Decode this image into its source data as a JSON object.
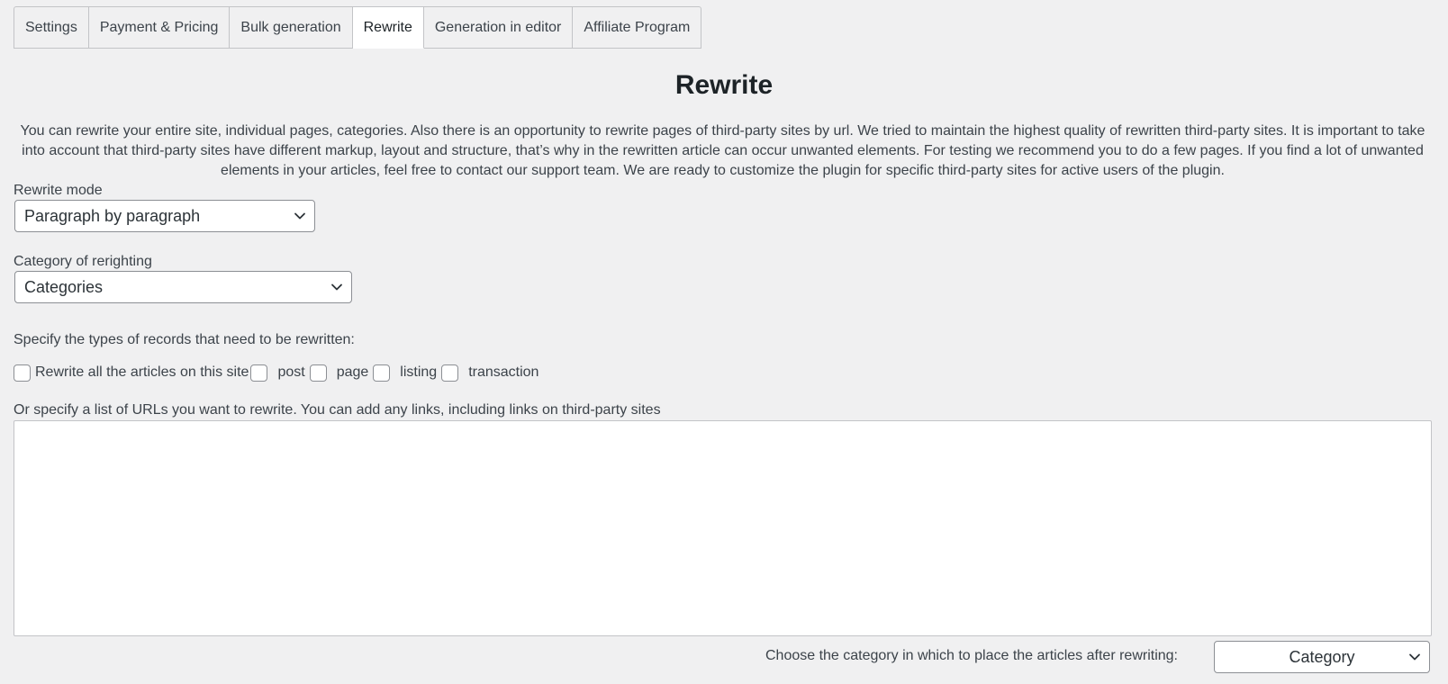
{
  "tabs": [
    {
      "label": "Settings",
      "active": false
    },
    {
      "label": "Payment & Pricing",
      "active": false
    },
    {
      "label": "Bulk generation",
      "active": false
    },
    {
      "label": "Rewrite",
      "active": true
    },
    {
      "label": "Generation in editor",
      "active": false
    },
    {
      "label": "Affiliate Program",
      "active": false
    }
  ],
  "page": {
    "title": "Rewrite",
    "intro": "You can rewrite your entire site, individual pages, categories. Also there is an opportunity to rewrite pages of third-party sites by url. We tried to maintain the highest quality of rewritten third-party sites. It is important to take into account that third-party sites have different markup, layout and structure, that’s why in the rewritten article can occur unwanted elements. For testing we recommend you to do a few pages. If you find a lot of unwanted elements in your articles, feel free to contact our support team. We are ready to customize the plugin for specific third-party sites for active users of the plugin."
  },
  "rewrite_mode": {
    "label": "Rewrite mode",
    "value": "Paragraph by paragraph"
  },
  "category_rewrite": {
    "label": "Category of rerighting",
    "value": "Categories"
  },
  "record_types": {
    "label": "Specify the types of records that need to be rewritten:",
    "options": [
      {
        "label": "Rewrite all the articles on this site",
        "checked": false
      },
      {
        "label": "post",
        "checked": false
      },
      {
        "label": "page",
        "checked": false
      },
      {
        "label": "listing",
        "checked": false
      },
      {
        "label": "transaction",
        "checked": false
      }
    ]
  },
  "urls": {
    "label": "Or specify a list of URLs you want to rewrite. You can add any links, including links on third-party sites",
    "value": ""
  },
  "target_category": {
    "label": "Choose the category in which to place the articles after rewriting:",
    "value": "Category"
  },
  "colors": {
    "background": "#f0f0f1",
    "border": "#c3c4c7",
    "text": "#3c434a",
    "title": "#1d2327"
  }
}
